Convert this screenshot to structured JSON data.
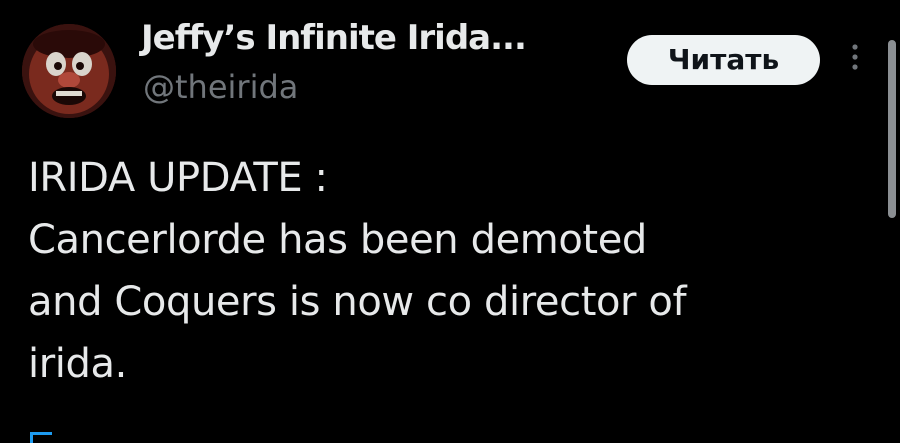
{
  "tweet": {
    "author": {
      "display_name": "Jeffy’s Infinite Irida...",
      "handle": "@theirida",
      "avatar_icon": "cartoon-face-avatar"
    },
    "follow_button_label": "Читать",
    "more_icon": "vertical-dots-icon",
    "text_lines": [
      "IRIDA UPDATE :",
      "Cancerlorde has been demoted",
      "and Coquers is now co director of",
      "irida."
    ]
  },
  "colors": {
    "background": "#000000",
    "primary_text": "#e7e9ea",
    "secondary_text": "#71767b",
    "button_bg": "#eff3f4",
    "button_text": "#0f1419",
    "accent": "#1d9bf0"
  }
}
